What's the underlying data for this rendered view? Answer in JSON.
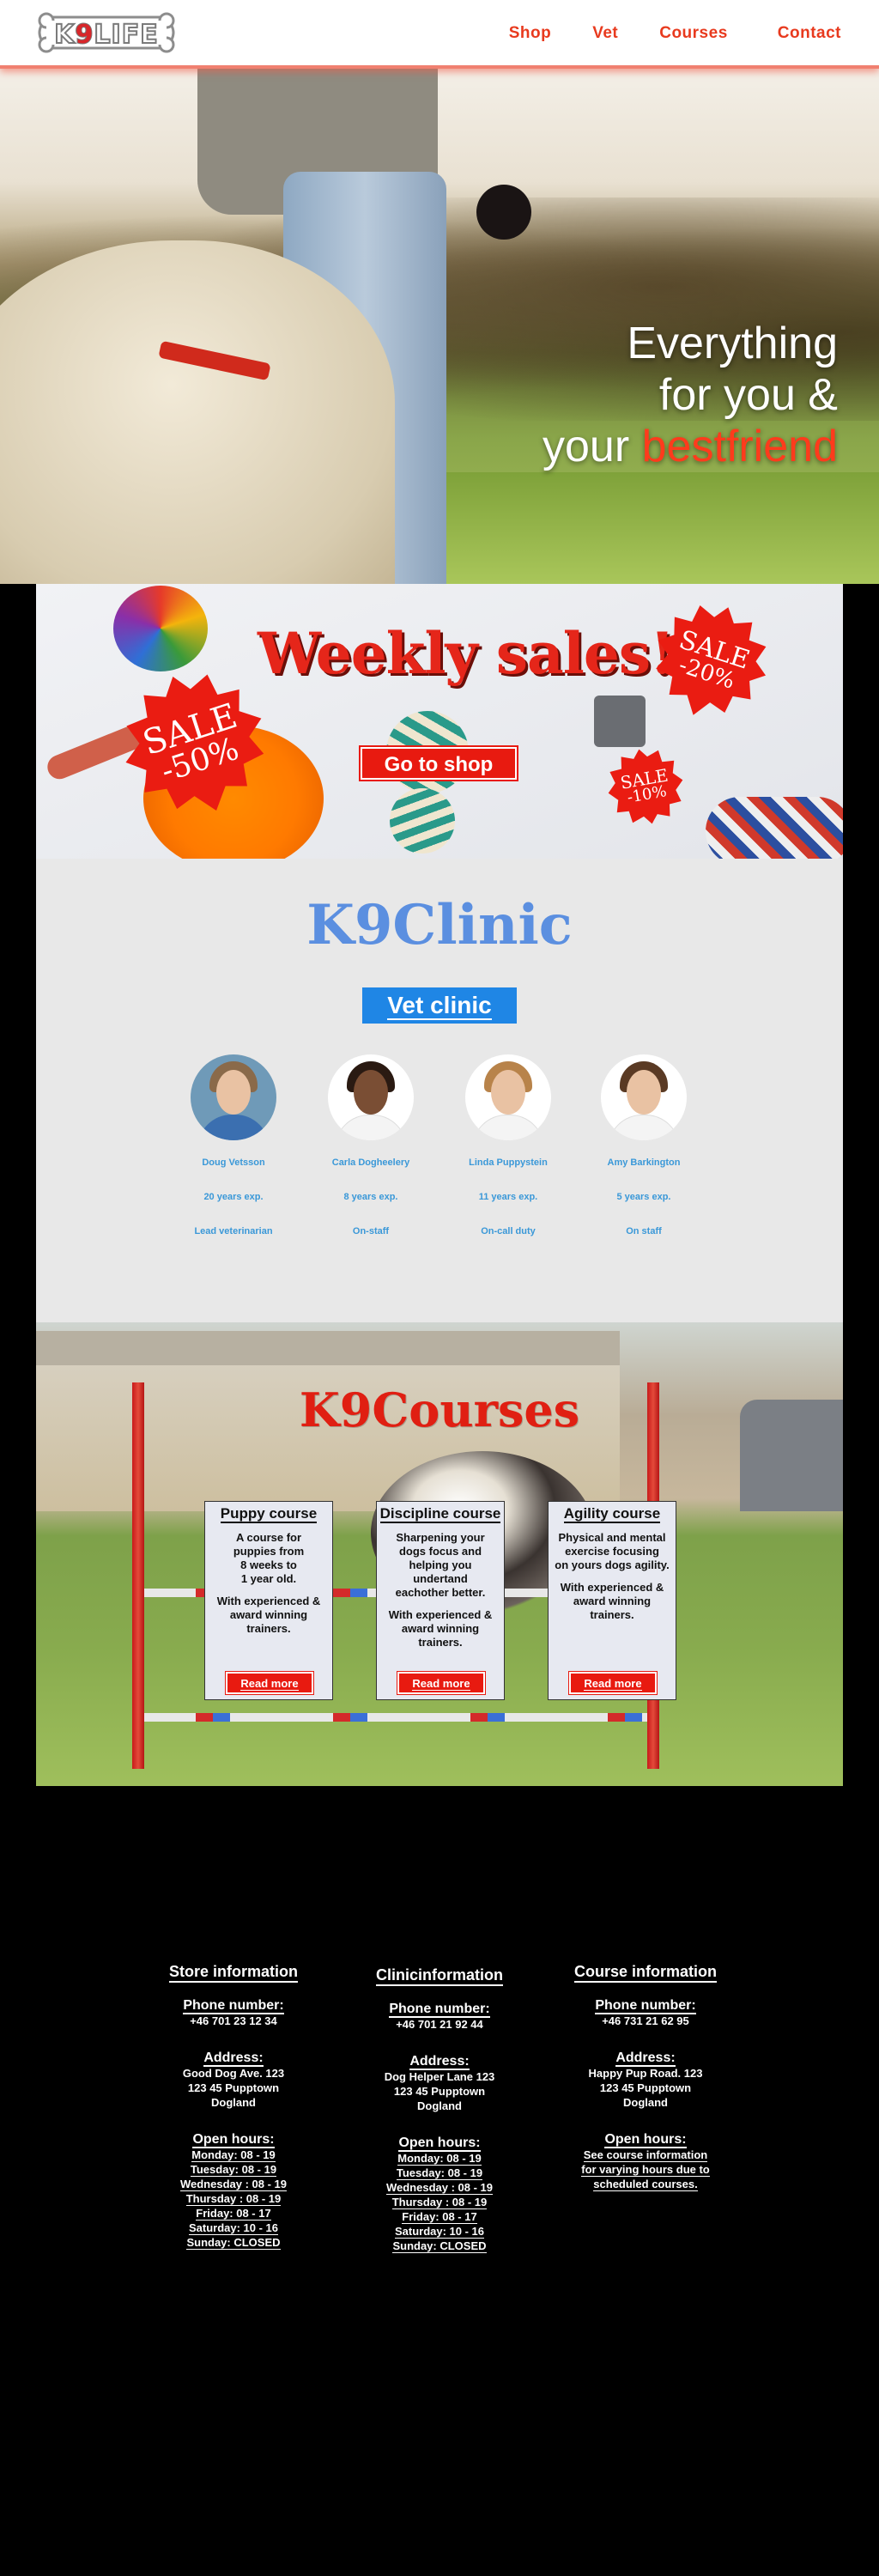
{
  "nav": {
    "logo_text": "K9LIFE",
    "links": [
      "Shop",
      "Vet",
      "Courses",
      "Contact"
    ]
  },
  "hero": {
    "line1": "Everything",
    "line2": "for you &",
    "line3_prefix": "your ",
    "line3_accent": "bestfriend"
  },
  "sales": {
    "title": "Weekly sales!",
    "badge_large": [
      "SALE",
      "-50%"
    ],
    "badge_top": [
      "SALE",
      "-20%"
    ],
    "badge_small": [
      "SALE",
      "-10%"
    ],
    "button": "Go to shop"
  },
  "clinic": {
    "title": "K9Clinic",
    "button": "Vet clinic",
    "staff": [
      {
        "name": "Doug Vetsson",
        "experience": "20 years exp.",
        "role": "Lead veterinarian"
      },
      {
        "name": "Carla Dogheelery",
        "experience": "8 years exp.",
        "role": "On-staff"
      },
      {
        "name": "Linda Puppystein",
        "experience": "11 years exp.",
        "role": "On-call duty"
      },
      {
        "name": "Amy Barkington",
        "experience": "5 years exp.",
        "role": "On staff"
      }
    ]
  },
  "courses": {
    "title": "K9Courses",
    "cards": [
      {
        "title": "Puppy course",
        "desc": [
          "A course for",
          "puppies from",
          "8 weeks to",
          "1 year old."
        ],
        "extra": [
          "With experienced &",
          "award winning",
          "trainers."
        ],
        "button": "Read more"
      },
      {
        "title": "Discipline course",
        "desc": [
          "Sharpening your",
          "dogs focus and",
          "helping you",
          "undertand",
          "eachother better."
        ],
        "extra": [
          "With experienced &",
          "award winning",
          "trainers."
        ],
        "button": "Read more"
      },
      {
        "title": "Agility course",
        "desc": [
          "Physical and mental",
          "exercise focusing",
          "on yours dogs agility."
        ],
        "extra": [
          "With experienced &",
          "award winning",
          "trainers."
        ],
        "button": "Read more"
      }
    ]
  },
  "footer": {
    "store": {
      "title": "Store information",
      "phone_label": "Phone number:",
      "phone": "+46 701 23 12 34",
      "address_label": "Address:",
      "address": [
        "Good Dog Ave. 123",
        "123 45 Pupptown",
        "Dogland"
      ],
      "hours_label": "Open hours:",
      "hours": [
        "Monday: 08 - 19",
        "Tuesday: 08 - 19",
        "Wednesday : 08 - 19",
        "Thursday : 08 - 19",
        "Friday: 08 - 17",
        "Saturday: 10 - 16",
        "Sunday: CLOSED"
      ]
    },
    "clinic": {
      "title": "Clinicinformation",
      "phone_label": "Phone number:",
      "phone": "+46 701 21 92 44",
      "address_label": "Address:",
      "address": [
        "Dog Helper Lane 123",
        "123 45 Pupptown",
        "Dogland"
      ],
      "hours_label": "Open hours:",
      "hours": [
        "Monday: 08 - 19",
        "Tuesday: 08 - 19",
        "Wednesday : 08 - 19",
        "Thursday : 08 - 19",
        "Friday: 08 - 17",
        "Saturday: 10 - 16",
        "Sunday: CLOSED"
      ]
    },
    "course": {
      "title": "Course information",
      "phone_label": "Phone number:",
      "phone": "+46 731 21 62 95",
      "address_label": "Address:",
      "address": [
        "Happy Pup Road. 123",
        "123 45 Pupptown",
        "Dogland"
      ],
      "hours_label": "Open hours:",
      "hours": [
        "See course information",
        "for varying hours due to",
        "scheduled courses."
      ]
    }
  },
  "colors": {
    "accent_red": "#e83a1e",
    "clinic_blue": "#5b8fe0",
    "button_blue": "#1f86e5"
  }
}
